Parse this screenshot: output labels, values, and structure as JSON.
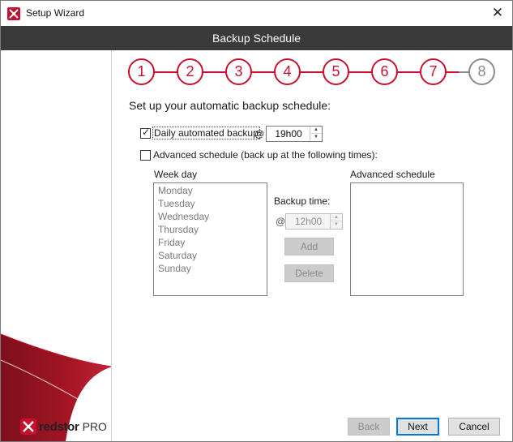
{
  "window": {
    "title": "Setup Wizard",
    "close_glyph": "✕",
    "icon": "redstor-app-icon"
  },
  "header": {
    "title": "Backup Schedule"
  },
  "branding": {
    "name": "redstor",
    "edition": "PRO",
    "accent_color": "#c8102e"
  },
  "steps": {
    "items": [
      "1",
      "2",
      "3",
      "4",
      "5",
      "6",
      "7",
      "8"
    ],
    "current": 8,
    "active_color": "#c8102e",
    "inactive_color": "#8a8a8a"
  },
  "intro": "Set up your automatic backup schedule:",
  "daily": {
    "checked": true,
    "label": "Daily automated backup",
    "at": "@",
    "time": "19h00"
  },
  "advanced": {
    "checked": false,
    "label": "Advanced schedule (back up at the following times):",
    "weekday_label": "Week day",
    "weekdays": [
      "Monday",
      "Tuesday",
      "Wednesday",
      "Thursday",
      "Friday",
      "Saturday",
      "Sunday"
    ],
    "backup_time_label": "Backup time:",
    "at": "@",
    "time": "12h00",
    "add_label": "Add",
    "delete_label": "Delete",
    "schedule_label": "Advanced schedule",
    "schedule_items": []
  },
  "footer": {
    "back_label": "Back",
    "next_label": "Next",
    "cancel_label": "Cancel"
  }
}
